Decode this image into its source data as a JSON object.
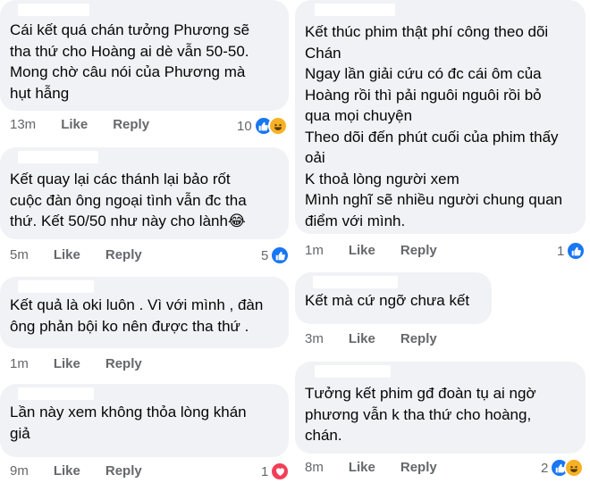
{
  "labels": {
    "like": "Like",
    "reply": "Reply"
  },
  "colors": {
    "bubble": "#f0f2f5",
    "like_blue": "#1877f2",
    "love_red": "#f33e58",
    "haha_yellow": "#f7b125",
    "meta_gray": "#65676b"
  },
  "left": [
    {
      "text": "Cái kết quá chán tưởng Phương sẽ\ntha thứ cho Hoàng ai dè vẫn 50-50.\nMong chờ câu nói của Phương mà\nhụt hẫng",
      "time": "13m",
      "reaction_count": "10",
      "reactions": [
        "like-icon",
        "haha-icon"
      ]
    },
    {
      "text": "Kết quay lại các thánh lại bảo rốt\ncuộc đàn ông ngoại tình vẫn đc tha\nthứ. Kết 50/50 như này cho lành😂",
      "time": "5m",
      "reaction_count": "5",
      "reactions": [
        "like-icon"
      ]
    },
    {
      "text": "Kết quả là oki luôn . Vì với mình , đàn\nông phản bội ko nên được tha thứ .",
      "time": "1m",
      "reaction_count": "",
      "reactions": []
    },
    {
      "text": "Lần này xem không thỏa lòng khán\ngiả",
      "time": "9m",
      "reaction_count": "1",
      "reactions": [
        "love-icon"
      ]
    }
  ],
  "right": [
    {
      "text": "Kết thúc phim thật phí công theo dõi\nChán\nNgay lần giải cứu có đc cái ôm của\nHoàng rồi thì pải nguôi nguôi rồi bỏ\nqua mọi chuyện\nTheo dõi đến phút cuối của phim thấy\noải\nK thoả lòng người xem\nMình nghĩ sẽ nhiều người chung quan\nđiểm với mình.",
      "time": "1m",
      "reaction_count": "1",
      "reactions": [
        "like-icon"
      ]
    },
    {
      "text": "Kết mà cứ ngỡ chưa kết",
      "time": "3m",
      "reaction_count": "",
      "reactions": []
    },
    {
      "text": "Tưởng kết phim gđ đoàn tụ ai ngờ\nphương vẫn k tha thứ cho hoàng,\nchán.",
      "time": "8m",
      "reaction_count": "2",
      "reactions": [
        "like-icon",
        "haha-icon"
      ]
    }
  ]
}
